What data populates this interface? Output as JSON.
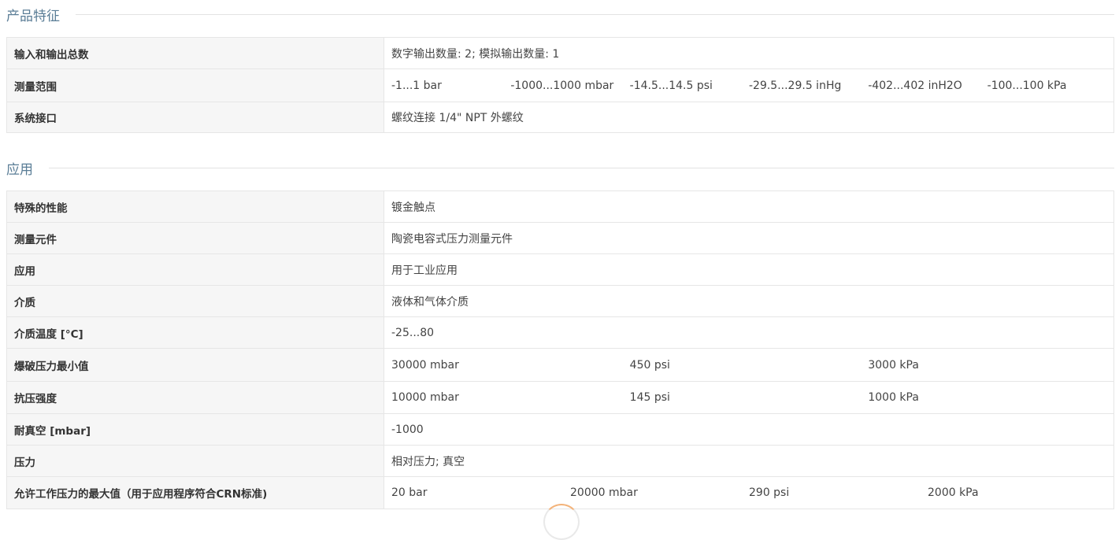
{
  "sections": {
    "features": {
      "title": "产品特征",
      "rows": [
        {
          "label": "输入和输出总数",
          "value": "数字输出数量: 2; 模拟输出数量: 1"
        },
        {
          "label": "测量范围",
          "values": [
            "-1...1 bar",
            "-1000...1000 mbar",
            "-14.5...14.5 psi",
            "-29.5...29.5 inHg",
            "-402...402 inH2O",
            "-100...100 kPa"
          ]
        },
        {
          "label": "系统接口",
          "value": "螺纹连接 1/4\" NPT 外螺纹"
        }
      ]
    },
    "application": {
      "title": "应用",
      "rows": [
        {
          "label": "特殊的性能",
          "value": "镀金触点"
        },
        {
          "label": "测量元件",
          "value": "陶瓷电容式压力测量元件"
        },
        {
          "label": "应用",
          "value": "用于工业应用"
        },
        {
          "label": "介质",
          "value": "液体和气体介质"
        },
        {
          "label": "介质温度 [°C]",
          "value": "-25...80"
        },
        {
          "label": "爆破压力最小值",
          "values": [
            "30000 mbar",
            "450 psi",
            "3000 kPa"
          ]
        },
        {
          "label": "抗压强度",
          "values": [
            "10000 mbar",
            "145 psi",
            "1000 kPa"
          ]
        },
        {
          "label": "耐真空 [mbar]",
          "value": "-1000"
        },
        {
          "label": "压力",
          "value": "相对压力; 真空"
        },
        {
          "label": "允许工作压力的最大值（用于应用程序符合CRN标准)",
          "values": [
            "20 bar",
            "20000 mbar",
            "290 psi",
            "2000 kPa"
          ]
        }
      ]
    }
  },
  "colors": {
    "heading": "#5a7d96",
    "label_bg": "#f6f6f6",
    "border": "#e6e6e6"
  }
}
